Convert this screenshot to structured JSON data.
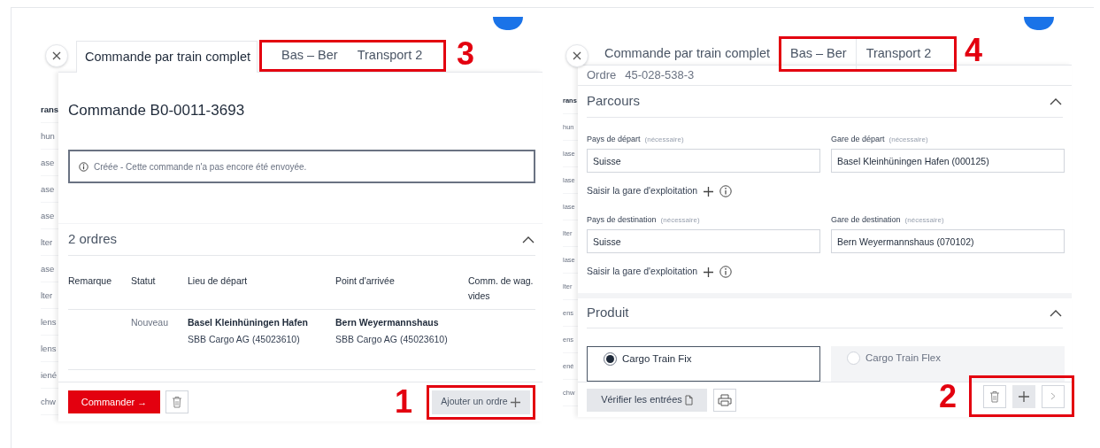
{
  "left_panel": {
    "background_list": [
      {
        "text": "rans",
        "bold": true
      },
      {
        "text": "hun",
        "bold": false
      },
      {
        "text": "ase",
        "bold": false
      },
      {
        "text": "ase",
        "bold": false
      },
      {
        "text": "ase",
        "bold": false
      },
      {
        "text": "lter",
        "bold": false
      },
      {
        "text": "ase",
        "bold": false
      },
      {
        "text": "lter",
        "bold": false
      },
      {
        "text": "lens",
        "bold": false
      },
      {
        "text": "lens",
        "bold": false
      },
      {
        "text": "iené",
        "bold": false
      },
      {
        "text": "chw",
        "bold": false
      }
    ],
    "tabs": [
      {
        "label": "Commande par train complet",
        "selected": true
      },
      {
        "label": "Bas – Ber",
        "selected": false
      },
      {
        "label": "Transport 2",
        "selected": false
      }
    ],
    "tabs_callout": "3",
    "title": "Commande B0-0011-3693",
    "notice": "Créée - Cette commande n'a pas encore été envoyée.",
    "section": {
      "title": "2 ordres",
      "expanded": true
    },
    "table": {
      "columns": [
        "Remarque",
        "Statut",
        "Lieu de départ",
        "Point d'arrivée",
        "Comm. de wag. vides"
      ],
      "rows": [
        {
          "status": "Nouveau",
          "departure": {
            "name": "Basel Kleinhüningen Hafen",
            "company": "SBB Cargo AG (45023610)"
          },
          "arrival": {
            "name": "Bern Weyermannshaus",
            "company": "SBB Cargo AG (45023610)"
          }
        }
      ]
    },
    "footer": {
      "order_button": "Commander →",
      "add_button": "Ajouter un ordre",
      "callout": "1"
    }
  },
  "right_panel": {
    "background_list": [
      {
        "text": "rans",
        "bold": true
      },
      {
        "text": "hun",
        "bold": false
      },
      {
        "text": "lase",
        "bold": false
      },
      {
        "text": "lase",
        "bold": false
      },
      {
        "text": "lase",
        "bold": false
      },
      {
        "text": "lter",
        "bold": false
      },
      {
        "text": "lase",
        "bold": false
      },
      {
        "text": "lter",
        "bold": false
      },
      {
        "text": "ens",
        "bold": false
      },
      {
        "text": "ens",
        "bold": false
      },
      {
        "text": "ené",
        "bold": false
      },
      {
        "text": "chw",
        "bold": false
      }
    ],
    "tabs": [
      {
        "label": "Commande par train complet",
        "selected": false
      },
      {
        "label": "Bas – Ber",
        "selected": false
      },
      {
        "label": "Transport 2",
        "selected": false
      }
    ],
    "tabs_callout": "4",
    "order": {
      "label": "Ordre",
      "number": "45-028-538-3"
    },
    "route": {
      "title": "Parcours",
      "expanded": true,
      "groups": [
        {
          "fields": [
            {
              "label": "Pays de départ",
              "hint": "(nécessaire)",
              "value": "Suisse"
            },
            {
              "label": "Gare de départ",
              "hint": "(nécessaire)",
              "value": "Basel Kleinhüningen Hafen (000125)"
            }
          ],
          "add_link": "Saisir la gare d'exploitation"
        },
        {
          "fields": [
            {
              "label": "Pays de destination",
              "hint": "(nécessaire)",
              "value": "Suisse"
            },
            {
              "label": "Gare de destination",
              "hint": "(nécessaire)",
              "value": "Bern Weyermannshaus (070102)"
            }
          ],
          "add_link": "Saisir la gare d'exploitation"
        }
      ]
    },
    "product": {
      "title": "Produit",
      "expanded": true,
      "options": [
        {
          "label": "Cargo Train Fix",
          "selected": true,
          "disabled": false
        },
        {
          "label": "Cargo Train Flex",
          "selected": false,
          "disabled": true
        }
      ]
    },
    "footer": {
      "check_button": "Vérifier les entrées",
      "callout": "2"
    }
  }
}
